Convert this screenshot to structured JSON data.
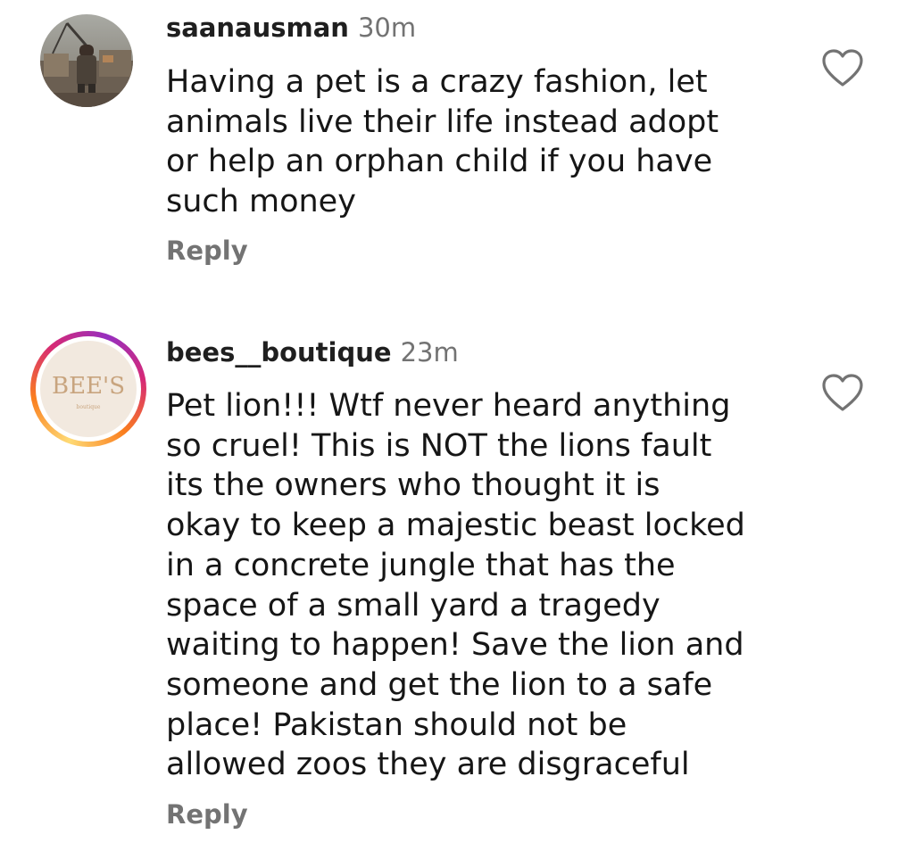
{
  "comments": [
    {
      "username": "saanausman",
      "time": "30m",
      "text": "Having a pet is a crazy fashion, let\nanimals live their life instead adopt\nor help an orphan child if you have\nsuch money",
      "reply_label": "Reply",
      "avatar": "photo",
      "like_icon": "heart-outline-icon"
    },
    {
      "username": "bees__boutique",
      "time": "23m",
      "text": "Pet lion!!! Wtf never heard anything\nso cruel! This is NOT the lions fault\nits the owners who thought it is\nokay to keep a majestic beast locked\nin a concrete jungle that has the\nspace of a small yard a tragedy\nwaiting to happen! Save the lion and\nsomeone and get the lion to a safe\nplace!  Pakistan should not be\nallowed zoos they are disgraceful",
      "reply_label": "Reply",
      "avatar": "logo",
      "avatar_logo_text": "BEE'S",
      "avatar_logo_subtext": "boutique",
      "has_story_ring": true,
      "like_icon": "heart-outline-icon"
    }
  ],
  "colors": {
    "username": "#1f1f1f",
    "meta": "#737373",
    "body": "#161616",
    "story_ring": [
      "#feda75",
      "#fa7e1e",
      "#d62976",
      "#962fbf"
    ]
  }
}
